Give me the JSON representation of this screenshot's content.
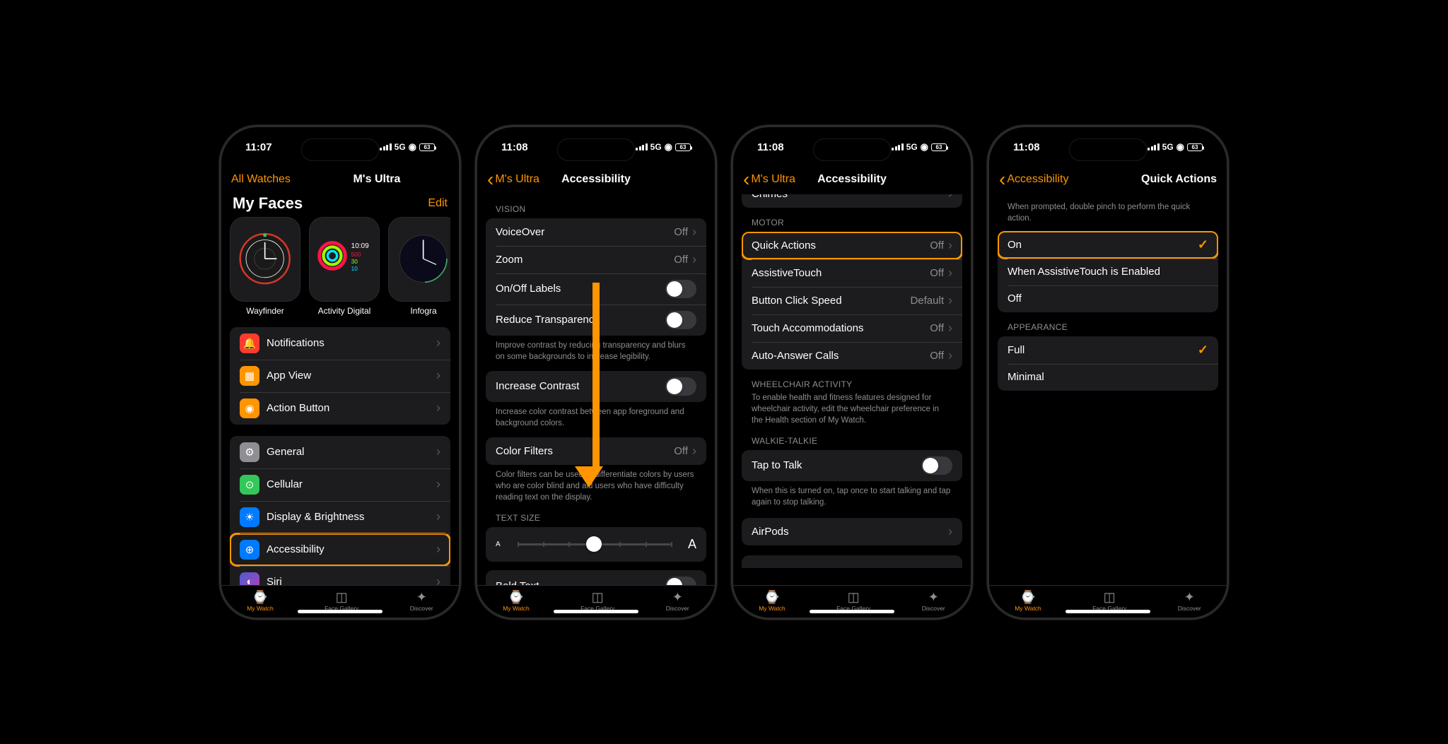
{
  "status": {
    "time1": "11:07",
    "time2": "11:08",
    "net": "5G",
    "batt": "63"
  },
  "s1": {
    "nav_left": "All Watches",
    "nav_title": "M's Ultra",
    "faces_title": "My Faces",
    "edit": "Edit",
    "faces": [
      "Wayfinder",
      "Activity Digital",
      "Infogra"
    ],
    "g1": [
      {
        "icon": "🔔",
        "bg": "#ff3b30",
        "label": "Notifications"
      },
      {
        "icon": "▦",
        "bg": "#ff9500",
        "label": "App View"
      },
      {
        "icon": "◉",
        "bg": "#ff9500",
        "label": "Action Button"
      }
    ],
    "g2": [
      {
        "icon": "⚙",
        "bg": "#8e8e93",
        "label": "General"
      },
      {
        "icon": "⊙",
        "bg": "#34c759",
        "label": "Cellular"
      },
      {
        "icon": "☀",
        "bg": "#007aff",
        "label": "Display & Brightness"
      },
      {
        "icon": "⊕",
        "bg": "#007aff",
        "label": "Accessibility",
        "hl": true
      },
      {
        "icon": "◐",
        "bg": "#6b4ba8",
        "label": "Siri"
      }
    ]
  },
  "s2": {
    "back": "M's Ultra",
    "title": "Accessibility",
    "vision_hdr": "VISION",
    "voiceover": {
      "label": "VoiceOver",
      "val": "Off"
    },
    "zoom": {
      "label": "Zoom",
      "val": "Off"
    },
    "labels": {
      "label": "On/Off Labels"
    },
    "reduce_t": {
      "label": "Reduce Transparency"
    },
    "reduce_t_note": "Improve contrast by reducing transparency and blurs on some backgrounds to increase legibility.",
    "contrast": {
      "label": "Increase Contrast"
    },
    "contrast_note": "Increase color contrast between app foreground and background colors.",
    "filters": {
      "label": "Color Filters",
      "val": "Off"
    },
    "filters_note": "Color filters can be used to differentiate colors by users who are color blind and aid users who have difficulty reading text on the display.",
    "textsize_hdr": "TEXT SIZE",
    "bold": {
      "label": "Bold Text"
    }
  },
  "s3": {
    "back": "M's Ultra",
    "title": "Accessibility",
    "chimes": "Chimes",
    "motor_hdr": "MOTOR",
    "motor": [
      {
        "label": "Quick Actions",
        "val": "Off",
        "hl": true
      },
      {
        "label": "AssistiveTouch",
        "val": "Off"
      },
      {
        "label": "Button Click Speed",
        "val": "Default"
      },
      {
        "label": "Touch Accommodations",
        "val": "Off"
      },
      {
        "label": "Auto-Answer Calls",
        "val": "Off"
      }
    ],
    "wc_hdr": "WHEELCHAIR ACTIVITY",
    "wc_note": "To enable health and fitness features designed for wheelchair activity, edit the wheelchair preference in the Health section of My Watch.",
    "wt_hdr": "WALKIE-TALKIE",
    "tap": {
      "label": "Tap to Talk"
    },
    "tap_note": "When this is turned on, tap once to start talking and tap again to stop talking.",
    "airpods": "AirPods"
  },
  "s4": {
    "back": "Accessibility",
    "title": "Quick Actions",
    "note": "When prompted, double pinch to perform the quick action.",
    "opts": [
      {
        "label": "On",
        "check": true,
        "hl": true
      },
      {
        "label": "When AssistiveTouch is Enabled"
      },
      {
        "label": "Off"
      }
    ],
    "app_hdr": "APPEARANCE",
    "app": [
      {
        "label": "Full",
        "check": true
      },
      {
        "label": "Minimal"
      }
    ]
  },
  "tabs": [
    {
      "label": "My Watch",
      "active": true
    },
    {
      "label": "Face Gallery"
    },
    {
      "label": "Discover"
    }
  ]
}
